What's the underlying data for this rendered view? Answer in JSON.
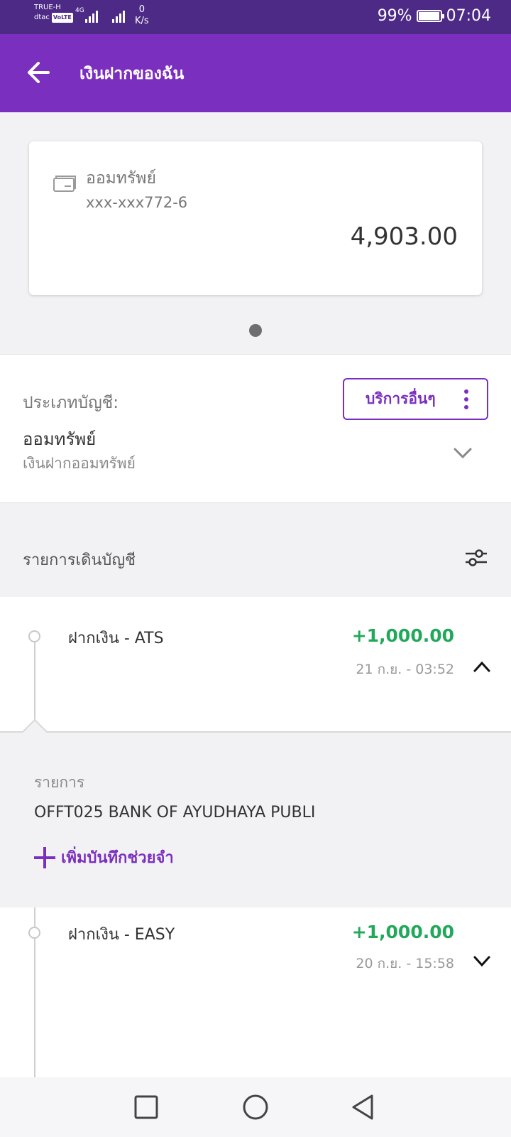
{
  "status_bar": {
    "carrier1": "TRUE-H",
    "carrier2": "dtac",
    "volte": "VoLTE",
    "network": "4G",
    "speed_value": "0",
    "speed_unit": "K/s",
    "battery_percent": "99%",
    "battery_level": 0.99,
    "time": "07:04"
  },
  "app_bar": {
    "title": "เงินฝากของฉัน"
  },
  "account_card": {
    "type": "ออมทรัพย์",
    "number": "xxx-xxx772-6",
    "balance": "4,903.00"
  },
  "account_info": {
    "label": "ประเภทบัญชี:",
    "type": "ออมทรัพย์",
    "subtype": "เงินฝากออมทรัพย์",
    "more_services": "บริการอื่นๆ"
  },
  "transactions": {
    "header": "รายการเดินบัญชี",
    "items": [
      {
        "name": "ฝากเงิน - ATS",
        "amount": "+1,000.00",
        "date": "21 ก.ย. - 03:52"
      },
      {
        "name": "ฝากเงิน - EASY",
        "amount": "+1,000.00",
        "date": "20 ก.ย. - 15:58"
      }
    ],
    "detail": {
      "label": "รายการ",
      "value": "OFFT025 BANK OF AYUDHAYA PUBLI",
      "add_memo": "เพิ่มบันทึกช่วยจำ"
    }
  },
  "colors": {
    "status_bar": "#4c2a86",
    "app_bar": "#7b2fbe",
    "accent": "#7b2fbe",
    "positive_amount": "#22a85a"
  }
}
